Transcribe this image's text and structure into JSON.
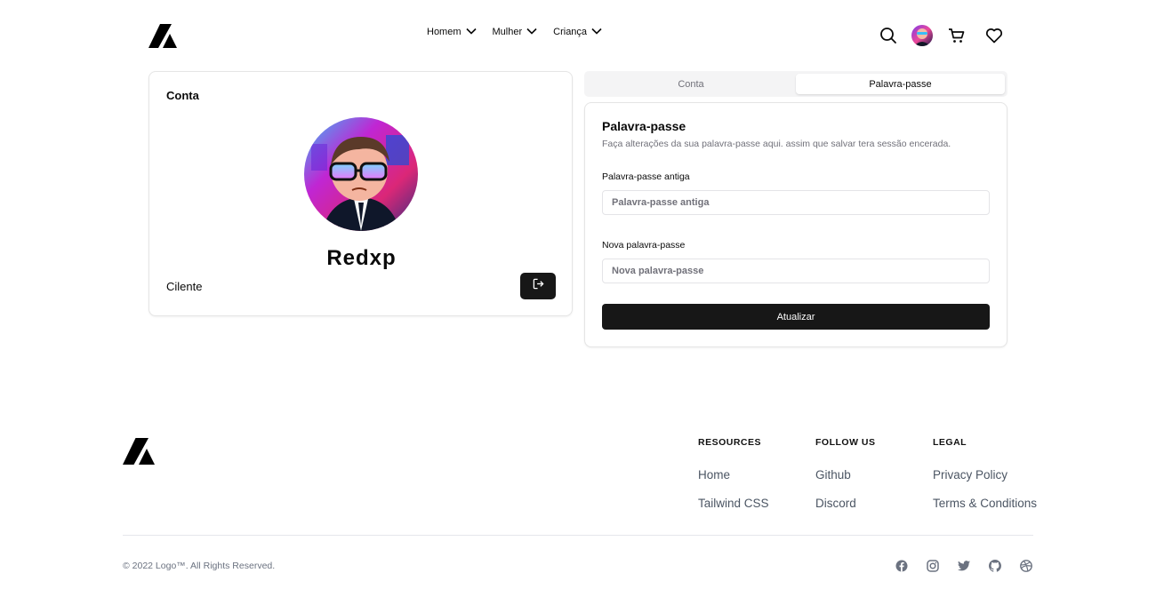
{
  "header": {
    "logo_icon": "triangle-logo-icon",
    "nav": [
      {
        "label": "Homem",
        "icon": "chevron-down-icon"
      },
      {
        "label": "Mulher",
        "icon": "chevron-down-icon"
      },
      {
        "label": "Criança",
        "icon": "chevron-down-icon"
      }
    ],
    "icons": [
      "search-icon",
      "avatar",
      "cart-icon",
      "heart-icon"
    ]
  },
  "profile": {
    "title": "Conta",
    "username": "Redxp",
    "role": "Cilente",
    "logout_icon": "logout-icon"
  },
  "tabs": [
    {
      "label": "Conta",
      "active": false
    },
    {
      "label": "Palavra-passe",
      "active": true
    }
  ],
  "password_form": {
    "title": "Palavra-passe",
    "description": "Faça alterações da sua palavra-passe aqui. assim que salvar tera sessão encerada.",
    "old_label": "Palavra-passe antiga",
    "old_placeholder": "Palavra-passe antiga",
    "old_value": "",
    "new_label": "Nova palavra-passe",
    "new_placeholder": "Nova palavra-passe",
    "new_value": "",
    "submit_label": "Atualizar"
  },
  "footer": {
    "columns": [
      {
        "heading": "Resources",
        "links": [
          "Home",
          "Tailwind CSS"
        ]
      },
      {
        "heading": "Follow us",
        "links": [
          "Github",
          "Discord"
        ]
      },
      {
        "heading": "Legal",
        "links": [
          "Privacy Policy",
          "Terms & Conditions"
        ]
      }
    ],
    "copyright": "© 2022 Logo™. All Rights Reserved.",
    "socials": [
      "facebook-icon",
      "instagram-icon",
      "twitter-icon",
      "github-icon",
      "dribbble-icon"
    ]
  },
  "colors": {
    "primary": "#171717",
    "muted_text": "#71717a",
    "border": "#e5e5e5",
    "tab_bg": "#f4f4f5"
  }
}
